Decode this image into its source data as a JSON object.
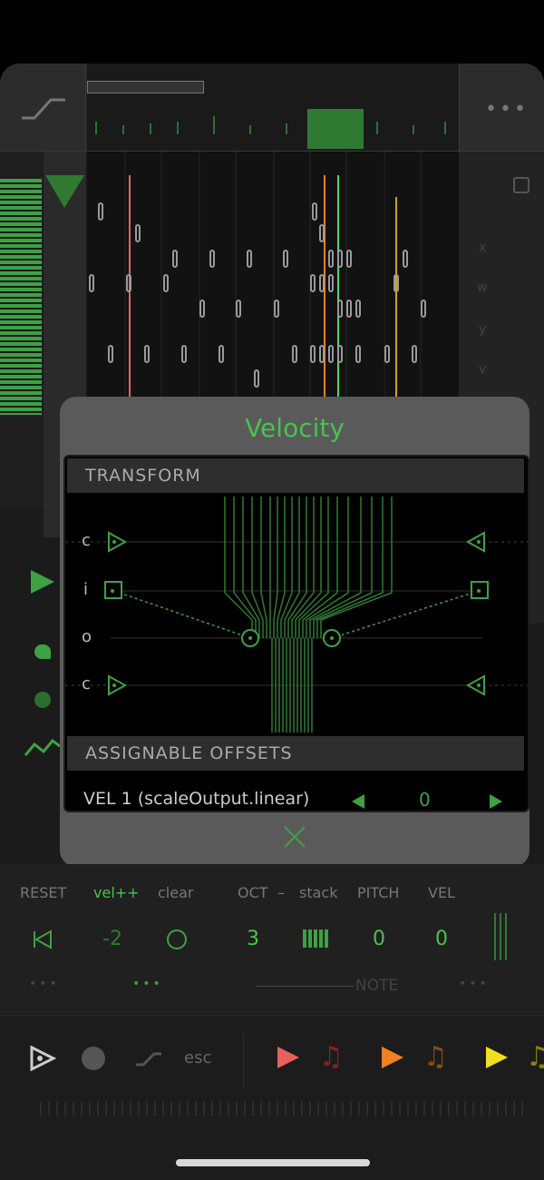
{
  "popup": {
    "title": "Velocity",
    "transform_header": "TRANSFORM",
    "rows": [
      "c",
      "i",
      "o",
      "c"
    ],
    "offsets_header": "ASSIGNABLE OFFSETS",
    "offset_item": {
      "label": "VEL 1 (scaleOutput.linear)",
      "value": "0"
    }
  },
  "bottom": {
    "reset": "RESET",
    "velpp": "vel++",
    "clear": "clear",
    "oct": "OCT",
    "dash": "–",
    "stack": "stack",
    "pitch": "PITCH",
    "vel": "VEL",
    "vel_value": "-2",
    "oct_value": "3",
    "pitch_value": "0",
    "vel2_value": "0",
    "note": "NOTE"
  },
  "transport": {
    "esc": "esc"
  },
  "side_labels": [
    "x",
    "w",
    "y",
    "v"
  ],
  "notes_label": "0",
  "colors": {
    "accent": "#49c24f",
    "red": "#e86060",
    "orange": "#f08020",
    "yellow": "#f0e020"
  }
}
